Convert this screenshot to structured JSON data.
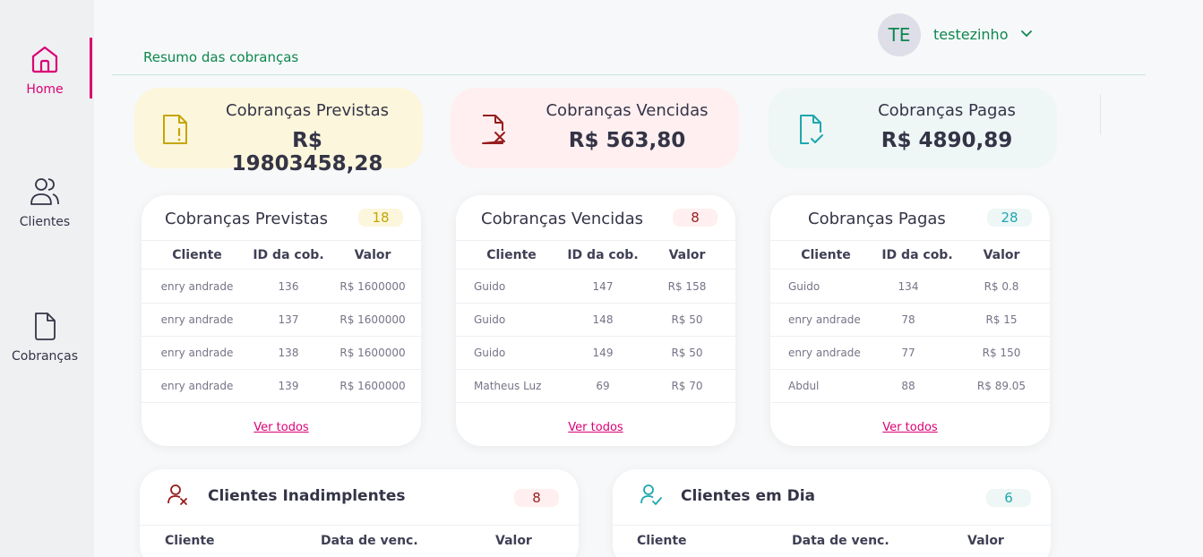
{
  "sidebar": {
    "items": [
      {
        "label": "Home",
        "icon": "home-icon",
        "active": true
      },
      {
        "label": "Clientes",
        "icon": "users-icon",
        "active": false
      },
      {
        "label": "Cobranças",
        "icon": "document-icon",
        "active": false
      }
    ],
    "accent_color": "#da0175"
  },
  "header": {
    "title": "Resumo das cobranças",
    "avatar_initials": "TE",
    "username": "testezinho",
    "color": "#0e8750"
  },
  "summary": [
    {
      "label": "Cobranças Previstas",
      "value": "R$ 19803458,28",
      "icon": "document-alert-icon",
      "color": "#fcf6dc"
    },
    {
      "label": "Cobranças Vencidas",
      "value": "R$ 563,80",
      "icon": "document-x-icon",
      "color": "#ffeff0"
    },
    {
      "label": "Cobranças Pagas",
      "value": "R$ 4890,89",
      "icon": "document-check-icon",
      "color": "#eef6f6"
    }
  ],
  "tables": [
    {
      "title": "Cobranças Previstas",
      "count": "18",
      "badge_color": "#fcf6dc",
      "badge_text_color": "#c5a605",
      "columns": [
        "Cliente",
        "ID da cob.",
        "Valor"
      ],
      "rows": [
        [
          "enry andrade",
          "136",
          "R$ 1600000"
        ],
        [
          "enry andrade",
          "137",
          "R$ 1600000"
        ],
        [
          "enry andrade",
          "138",
          "R$ 1600000"
        ],
        [
          "enry andrade",
          "139",
          "R$ 1600000"
        ]
      ],
      "link": "Ver todos"
    },
    {
      "title": "Cobranças Vencidas",
      "count": "8",
      "badge_color": "#ffeff0",
      "badge_text_color": "#971d1d",
      "columns": [
        "Cliente",
        "ID da cob.",
        "Valor"
      ],
      "rows": [
        [
          "Guido",
          "147",
          "R$ 158"
        ],
        [
          "Guido",
          "148",
          "R$ 50"
        ],
        [
          "Guido",
          "149",
          "R$ 50"
        ],
        [
          "Matheus Luz",
          "69",
          "R$ 70"
        ]
      ],
      "link": "Ver todos"
    },
    {
      "title": "Cobranças Pagas",
      "count": "28",
      "badge_color": "#eef6f6",
      "badge_text_color": "#1fa7af",
      "columns": [
        "Cliente",
        "ID da cob.",
        "Valor"
      ],
      "rows": [
        [
          "Guido",
          "134",
          "R$ 0.8"
        ],
        [
          "enry andrade",
          "78",
          "R$ 15"
        ],
        [
          "enry andrade",
          "77",
          "R$ 150"
        ],
        [
          "Abdul",
          "88",
          "R$ 89.05"
        ]
      ],
      "link": "Ver todos"
    }
  ],
  "clients": [
    {
      "title": "Clientes Inadimplentes",
      "count": "8",
      "icon": "user-x-icon",
      "badge_color": "#ffeff0",
      "badge_text_color": "#971d1d",
      "columns": [
        "Cliente",
        "Data de venc.",
        "Valor"
      ]
    },
    {
      "title": "Clientes em Dia",
      "count": "6",
      "icon": "user-check-icon",
      "badge_color": "#eef6f6",
      "badge_text_color": "#1fa7af",
      "columns": [
        "Cliente",
        "Data de venc.",
        "Valor"
      ]
    }
  ]
}
